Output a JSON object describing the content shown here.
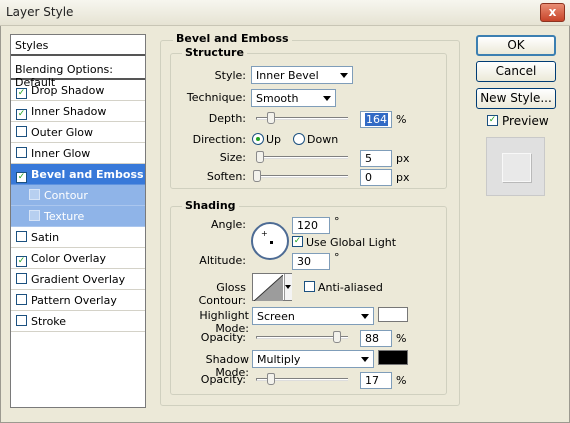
{
  "window": {
    "title": "Layer Style",
    "close_label": "x"
  },
  "sidebar": {
    "header": "Styles",
    "blending": "Blending Options: Default",
    "items": [
      {
        "label": "Drop Shadow",
        "checked": true
      },
      {
        "label": "Inner Shadow",
        "checked": true
      },
      {
        "label": "Outer Glow",
        "checked": false
      },
      {
        "label": "Inner Glow",
        "checked": false
      },
      {
        "label": "Bevel and Emboss",
        "checked": true
      },
      {
        "label": "Contour",
        "checked": false
      },
      {
        "label": "Texture",
        "checked": false
      },
      {
        "label": "Satin",
        "checked": false
      },
      {
        "label": "Color Overlay",
        "checked": true
      },
      {
        "label": "Gradient Overlay",
        "checked": false
      },
      {
        "label": "Pattern Overlay",
        "checked": false
      },
      {
        "label": "Stroke",
        "checked": false
      }
    ]
  },
  "bevel": {
    "title": "Bevel and Emboss",
    "structure": {
      "title": "Structure",
      "style_label": "Style:",
      "style_value": "Inner Bevel",
      "technique_label": "Technique:",
      "technique_value": "Smooth",
      "depth_label": "Depth:",
      "depth_value": "164",
      "depth_unit": "%",
      "direction_label": "Direction:",
      "dir_up": "Up",
      "dir_down": "Down",
      "size_label": "Size:",
      "size_value": "5",
      "size_unit": "px",
      "soften_label": "Soften:",
      "soften_value": "0",
      "soften_unit": "px"
    },
    "shading": {
      "title": "Shading",
      "angle_label": "Angle:",
      "angle_value": "120",
      "angle_unit": "°",
      "global_light_label": "Use Global Light",
      "altitude_label": "Altitude:",
      "altitude_value": "30",
      "altitude_unit": "°",
      "gloss_label": "Gloss Contour:",
      "anti_aliased_label": "Anti-aliased",
      "highlight_label": "Highlight Mode:",
      "highlight_value": "Screen",
      "highlight_color": "#ffffff",
      "opacity1_label": "Opacity:",
      "opacity1_value": "88",
      "opacity1_unit": "%",
      "shadow_label": "Shadow Mode:",
      "shadow_value": "Multiply",
      "shadow_color": "#000000",
      "opacity2_label": "Opacity:",
      "opacity2_value": "17",
      "opacity2_unit": "%"
    }
  },
  "buttons": {
    "ok": "OK",
    "cancel": "Cancel",
    "new_style": "New Style...",
    "preview": "Preview"
  }
}
